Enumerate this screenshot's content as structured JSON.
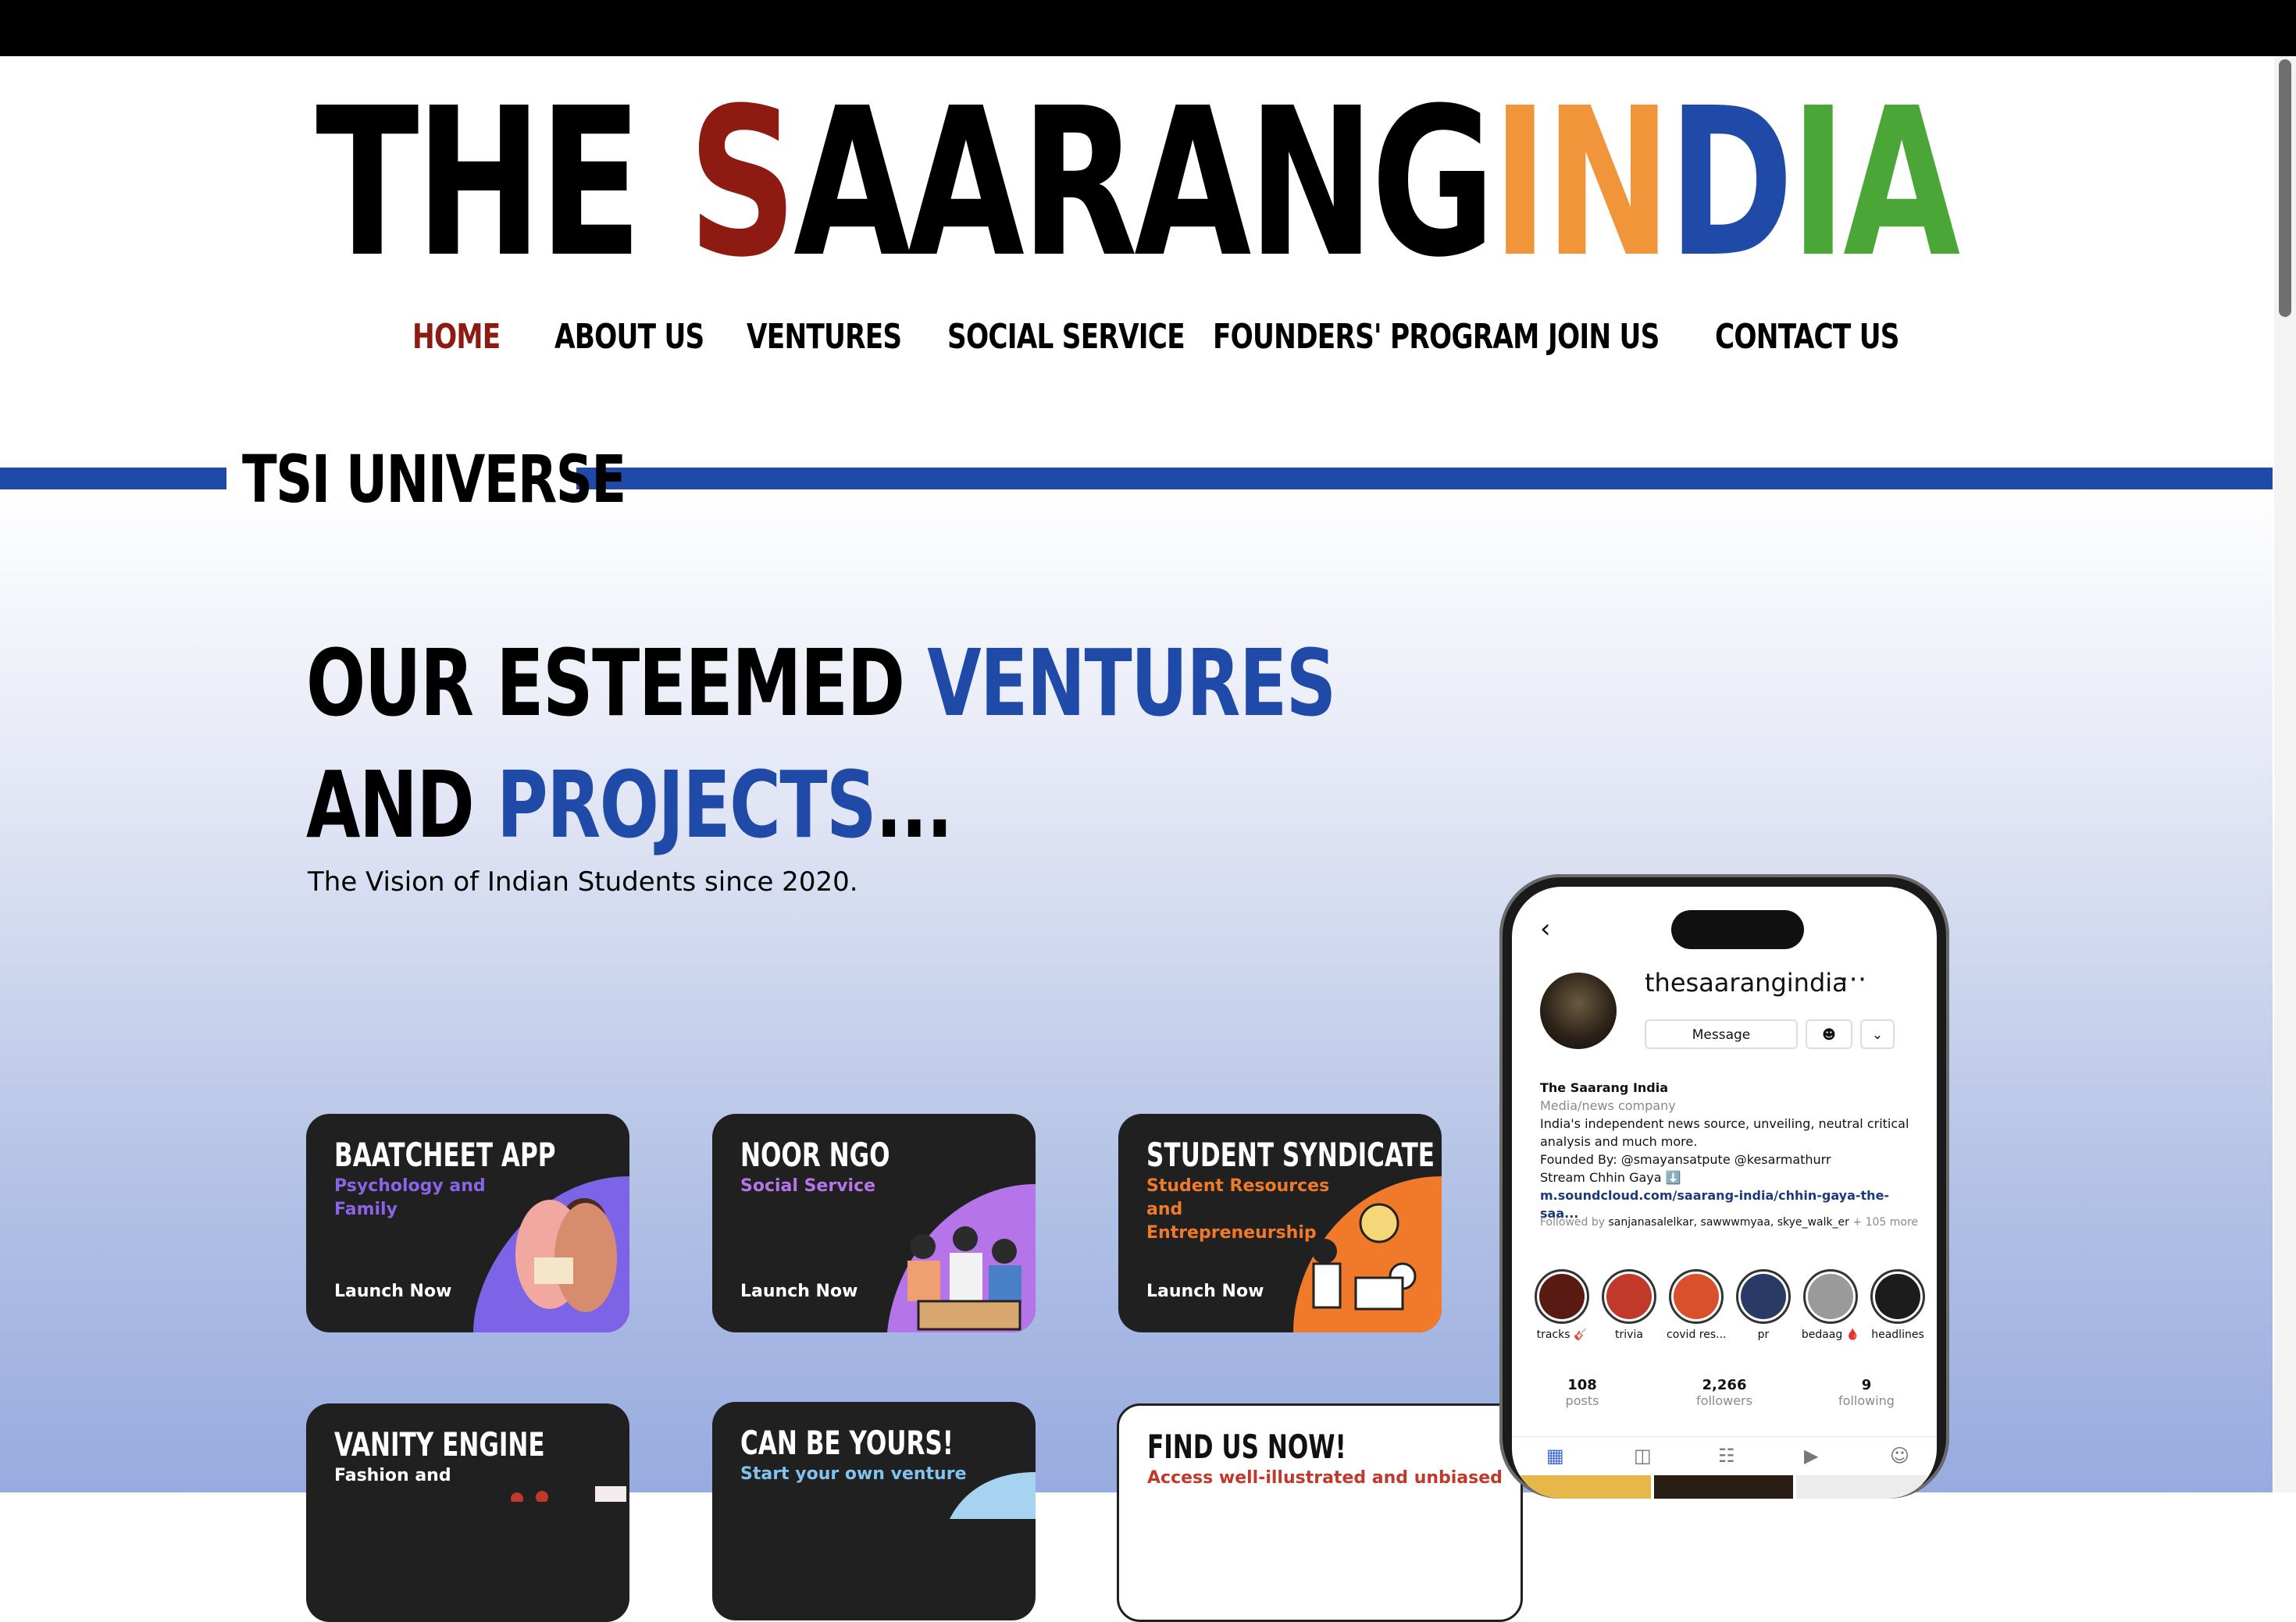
{
  "logo": {
    "the": "THE ",
    "s": "S",
    "aarang": "AARANG",
    "i": "I",
    "n": "N",
    "d": "D",
    "ia": "IA"
  },
  "nav": [
    "HOME",
    "ABOUT US",
    "VENTURES",
    "SOCIAL SERVICE",
    "FOUNDERS' PROGRAM",
    "JOIN US",
    "CONTACT US"
  ],
  "section": {
    "title": "TSI UNIVERSE"
  },
  "hero": {
    "h1a": "OUR ESTEEMED ",
    "h1b": "VENTURES",
    "h2a": "AND ",
    "h2b": "PROJECTS",
    "h2c": "...",
    "tagline": "The Vision of Indian Students since 2020."
  },
  "cards": [
    {
      "title": "BAATCHEET APP",
      "subtitle": "Psychology and Family",
      "launch": "Launch Now",
      "sub_color": "#8b63e6"
    },
    {
      "title": "NOOR NGO",
      "subtitle": "Social Service",
      "launch": "Launch Now",
      "sub_color": "#b575e8"
    },
    {
      "title": "STUDENT SYNDICATE",
      "subtitle": "Student Resources and Entrepreneurship",
      "launch": "Launch Now",
      "sub_color": "#f07a2a"
    },
    {
      "title": "VANITY ENGINE",
      "subtitle": "Fashion and",
      "launch": "",
      "sub_color": "#ffffff"
    },
    {
      "title": "CAN BE YOURS!",
      "subtitle": "Start your own venture",
      "launch": "",
      "sub_color": "#7fc3ee"
    },
    {
      "title": "FIND US NOW!",
      "subtitle": "Access well-illustrated and unbiased",
      "launch": "",
      "sub_color": "#c0392b"
    }
  ],
  "instagram": {
    "handle": "thesaarangindia",
    "message_button": "Message",
    "bio_name": "The Saarang India",
    "bio_category": "Media/news company",
    "bio_line1": "India's independent news source, unveiling, neutral critical analysis and much more.",
    "bio_line2": "Founded By: @smayansatpute @kesarmathurr",
    "bio_line3": "Stream Chhin Gaya ⬇️",
    "bio_link": "m.soundcloud.com/saarang-india/chhin-gaya-the-saa...",
    "followed_by_prefix": "Followed by ",
    "followed_by_names": "sanjanasalelkar, sawwwmyaa, skye_walk_er",
    "followed_by_suffix": " + 105 more",
    "highlights": [
      "tracks 🎸",
      "trivia",
      "covid res...",
      "pr",
      "bedaag 🩸",
      "headlines"
    ],
    "stats": [
      {
        "n": "108",
        "l": "posts"
      },
      {
        "n": "2,266",
        "l": "followers"
      },
      {
        "n": "9",
        "l": "following"
      }
    ]
  }
}
